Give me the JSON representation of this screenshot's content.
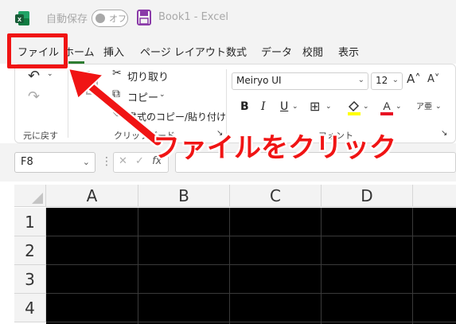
{
  "titlebar": {
    "autosave_label": "自動保存",
    "autosave_state": "オフ",
    "doc_title": "Book1  -  Excel"
  },
  "menu": {
    "tabs": [
      {
        "label": "ファイル"
      },
      {
        "label": "ホーム"
      },
      {
        "label": "挿入"
      },
      {
        "label": "ページ レイアウト"
      },
      {
        "label": "数式"
      },
      {
        "label": "データ"
      },
      {
        "label": "校閲"
      },
      {
        "label": "表示"
      }
    ]
  },
  "ribbon": {
    "undo_group_label": "元に戻す",
    "cut_label": "切り取り",
    "copy_label": "コピー",
    "format_painter_label": "書式のコピー/貼り付け",
    "clipboard_label": "クリップボード",
    "font_name": "Meiryo UI",
    "font_size": "12",
    "font_group_label": "フォント",
    "bold": "B",
    "italic": "I",
    "underline": "U"
  },
  "formula_bar": {
    "name_box": "F8",
    "fx": "fx"
  },
  "sheet": {
    "columns": [
      "A",
      "B",
      "C",
      "D"
    ],
    "rows": [
      "1",
      "2",
      "3",
      "4"
    ]
  },
  "annotation": {
    "text": "ファイルをクリック"
  },
  "colors": {
    "excel_green": "#107c41",
    "annotation_red": "#f01414",
    "cell_fill": "#000000"
  }
}
